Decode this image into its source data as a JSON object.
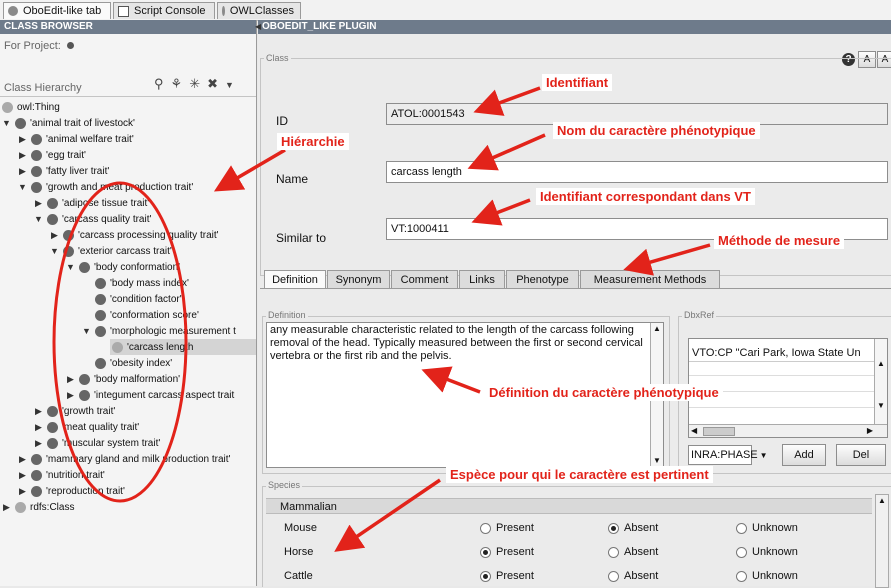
{
  "tabs": [
    "OboEdit-like tab",
    "Script Console",
    "OWLClasses"
  ],
  "left_panel": {
    "title": "CLASS BROWSER",
    "for_project": "For Project:",
    "hierarchy_label": "Class Hierarchy",
    "tree": [
      {
        "label": "owl:Thing"
      },
      {
        "label": "'animal trait of livestock'"
      },
      {
        "label": "'animal welfare trait'"
      },
      {
        "label": "'egg trait'"
      },
      {
        "label": "'fatty liver trait'"
      },
      {
        "label": "'growth and meat production trait'"
      },
      {
        "label": "'adipose tissue trait'"
      },
      {
        "label": "'carcass quality trait'"
      },
      {
        "label": "'carcass processing quality trait'"
      },
      {
        "label": "'exterior carcass trait'"
      },
      {
        "label": "'body conformation'"
      },
      {
        "label": "'body mass index'"
      },
      {
        "label": "'condition factor'"
      },
      {
        "label": "'conformation score'"
      },
      {
        "label": "'morphologic measurement t"
      },
      {
        "label": "'carcass length"
      },
      {
        "label": "'obesity index'"
      },
      {
        "label": "'body malformation'"
      },
      {
        "label": "'integument carcass aspect trait"
      },
      {
        "label": "'growth trait'"
      },
      {
        "label": "'meat quality trait'"
      },
      {
        "label": "'muscular system trait'"
      },
      {
        "label": "'mammary gland and milk production trait'"
      },
      {
        "label": "'nutrition trait'"
      },
      {
        "label": "'reproduction trait'"
      },
      {
        "label": "rdfs:Class"
      }
    ]
  },
  "right_panel": {
    "title": "OBOEDIT_LIKE PLUGIN",
    "help_icon": "?",
    "font_buttons": [
      "A",
      "A"
    ],
    "class_group": "Class",
    "id_label": "ID",
    "id_value": "ATOL:0001543",
    "name_label": "Name",
    "name_value": "carcass length",
    "similar_label": "Similar to",
    "similar_value": "VT:1000411",
    "detail_tabs": [
      "Definition",
      "Synonym",
      "Comment",
      "Links",
      "Phenotype",
      "Measurement Methods"
    ],
    "definition_group": "Definition",
    "definition_text": "any measurable characteristic related to the length of the carcass following removal of the head. Typically measured between the first or second cervical vertebra or the first rib and the pelvis.",
    "dbxref_group": "DbxRef",
    "dbxref_value": "VTO:CP \"Cari Park, Iowa State Un",
    "dbxref_select": "INRA:PHASE",
    "add_button": "Add",
    "del_button": "Del",
    "species_group": "Species",
    "species_header": "Mammalian",
    "radio_options": [
      "Present",
      "Absent",
      "Unknown"
    ],
    "species": [
      {
        "name": "Mouse",
        "selected": "Absent"
      },
      {
        "name": "Horse",
        "selected": "Present"
      },
      {
        "name": "Cattle",
        "selected": "Present"
      }
    ]
  },
  "annotations": {
    "identifiant": "Identifiant",
    "nom": "Nom du caractère phénotypique",
    "hierarchie": "Hiérarchie",
    "vt": "Identifiant correspondant dans VT",
    "methode": "Méthode de mesure",
    "definition": "Définition du caractère phénotypique",
    "espece": "Espèce pour qui le caractère est pertinent"
  },
  "colors": {
    "annotation": "#e2231a",
    "panel_title": "#6e7b8b"
  }
}
